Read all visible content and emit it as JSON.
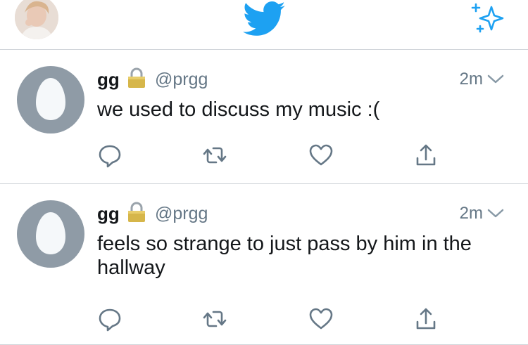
{
  "header": {
    "profile_icon": "profile-avatar",
    "logo_icon": "twitter-bird-icon",
    "compose_icon": "sparkle-icon",
    "brand_color": "#1da1f2"
  },
  "tweets": [
    {
      "name": "gg",
      "protected_icon": "lock-icon",
      "handle": "@prgg",
      "time": "2m",
      "text": "we used to discuss my music :("
    },
    {
      "name": "gg",
      "protected_icon": "lock-icon",
      "handle": "@prgg",
      "time": "2m",
      "text": "feels so strange to just pass by him in the hallway"
    }
  ],
  "actions": [
    "reply-icon",
    "retweet-icon",
    "like-icon",
    "share-icon"
  ],
  "colors": {
    "secondary_text": "#657786",
    "icon": "#657786",
    "divider": "#cfd4d9",
    "egg_bg": "#8f9ba6"
  }
}
